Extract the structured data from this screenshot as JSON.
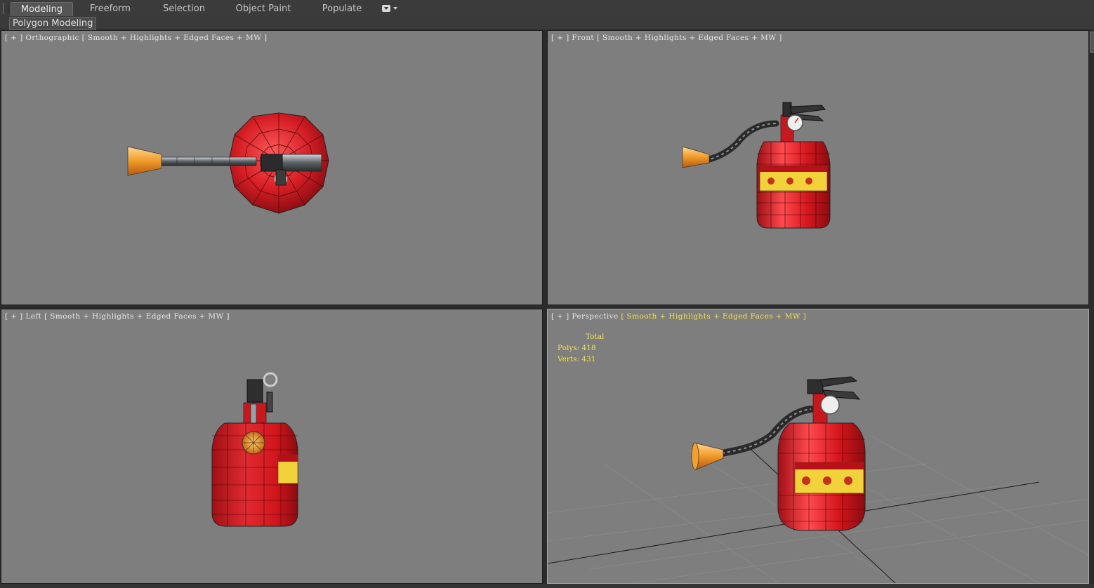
{
  "ribbon": {
    "tabs": [
      {
        "label": "Modeling",
        "active": true
      },
      {
        "label": "Freeform",
        "active": false
      },
      {
        "label": "Selection",
        "active": false
      },
      {
        "label": "Object Paint",
        "active": false
      },
      {
        "label": "Populate",
        "active": false
      }
    ],
    "extra_icon": "dropdown-menu-icon"
  },
  "subbar": {
    "label": "Polygon Modeling"
  },
  "viewports": [
    {
      "plus": "[ + ]",
      "view": "Orthographic",
      "shading": "[ Smooth + Highlights + Edged Faces + MW ]",
      "active": false
    },
    {
      "plus": "[ + ]",
      "view": "Front",
      "shading": "[ Smooth + Highlights + Edged Faces + MW ]",
      "active": false
    },
    {
      "plus": "[ + ]",
      "view": "Left",
      "shading": "[ Smooth + Highlights + Edged Faces + MW ]",
      "active": false
    },
    {
      "plus": "[ + ]",
      "view": "Perspective",
      "shading": "[ Smooth + Highlights + Edged Faces + MW ]",
      "active": true
    }
  ],
  "stats": {
    "title": "Total",
    "polys_label": "Polys:",
    "polys": "418",
    "verts_label": "Verts:",
    "verts": "431"
  },
  "colors": {
    "viewport_bg": "#7e7e7e",
    "highlight_text": "#f5e14a",
    "extinguisher_red": "#d9262a",
    "nozzle_orange": "#f0a030"
  }
}
